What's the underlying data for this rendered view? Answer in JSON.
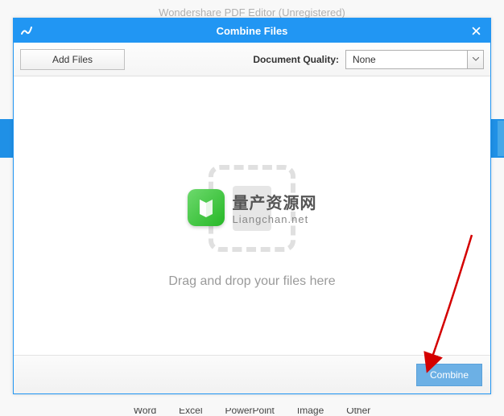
{
  "background": {
    "appTitle": "Wondershare PDF Editor (Unregistered)",
    "toolbarItems": [
      "Word",
      "Excel",
      "PowerPoint",
      "Image",
      "Other"
    ]
  },
  "modal": {
    "title": "Combine Files",
    "addFilesLabel": "Add Files",
    "qualityLabel": "Document Quality:",
    "qualityValue": "None",
    "dropHint": "Drag and drop your files here",
    "combineLabel": "Combine"
  },
  "watermark": {
    "textCn": "量产资源网",
    "url": "Liangchan.net"
  }
}
